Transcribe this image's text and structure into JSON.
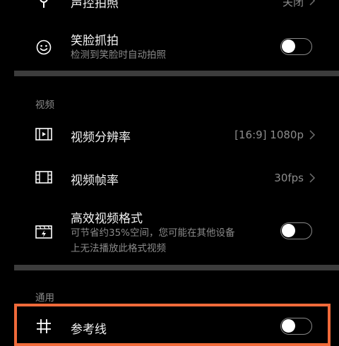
{
  "rows": {
    "voice_photo": {
      "title": "声控拍照",
      "value": "关闭",
      "icon": "microphone-icon"
    },
    "smile_capture": {
      "title": "笑脸抓拍",
      "subtitle": "检测到笑脸时自动拍照",
      "icon": "smile-icon",
      "enabled": false
    },
    "video_resolution": {
      "title": "视频分辨率",
      "value": "[16:9] 1080p",
      "icon": "video-resolution-icon"
    },
    "video_frame_rate": {
      "title": "视频帧率",
      "value": "30fps",
      "icon": "film-icon"
    },
    "efficient_format": {
      "title": "高效视频格式",
      "subtitle_line1": "可节省约35%空间，您可能在其他设备",
      "subtitle_line2": "上无法播放此格式视频",
      "icon": "efficient-video-icon",
      "enabled": false
    },
    "grid_lines": {
      "title": "参考线",
      "icon": "grid-icon",
      "enabled": false
    }
  },
  "sections": {
    "video": "视频",
    "general": "通用"
  },
  "colors": {
    "background": "#000000",
    "divider": "#3c3c3c",
    "highlight": "#f06a3a",
    "secondary_text": "#8a8a8a"
  }
}
